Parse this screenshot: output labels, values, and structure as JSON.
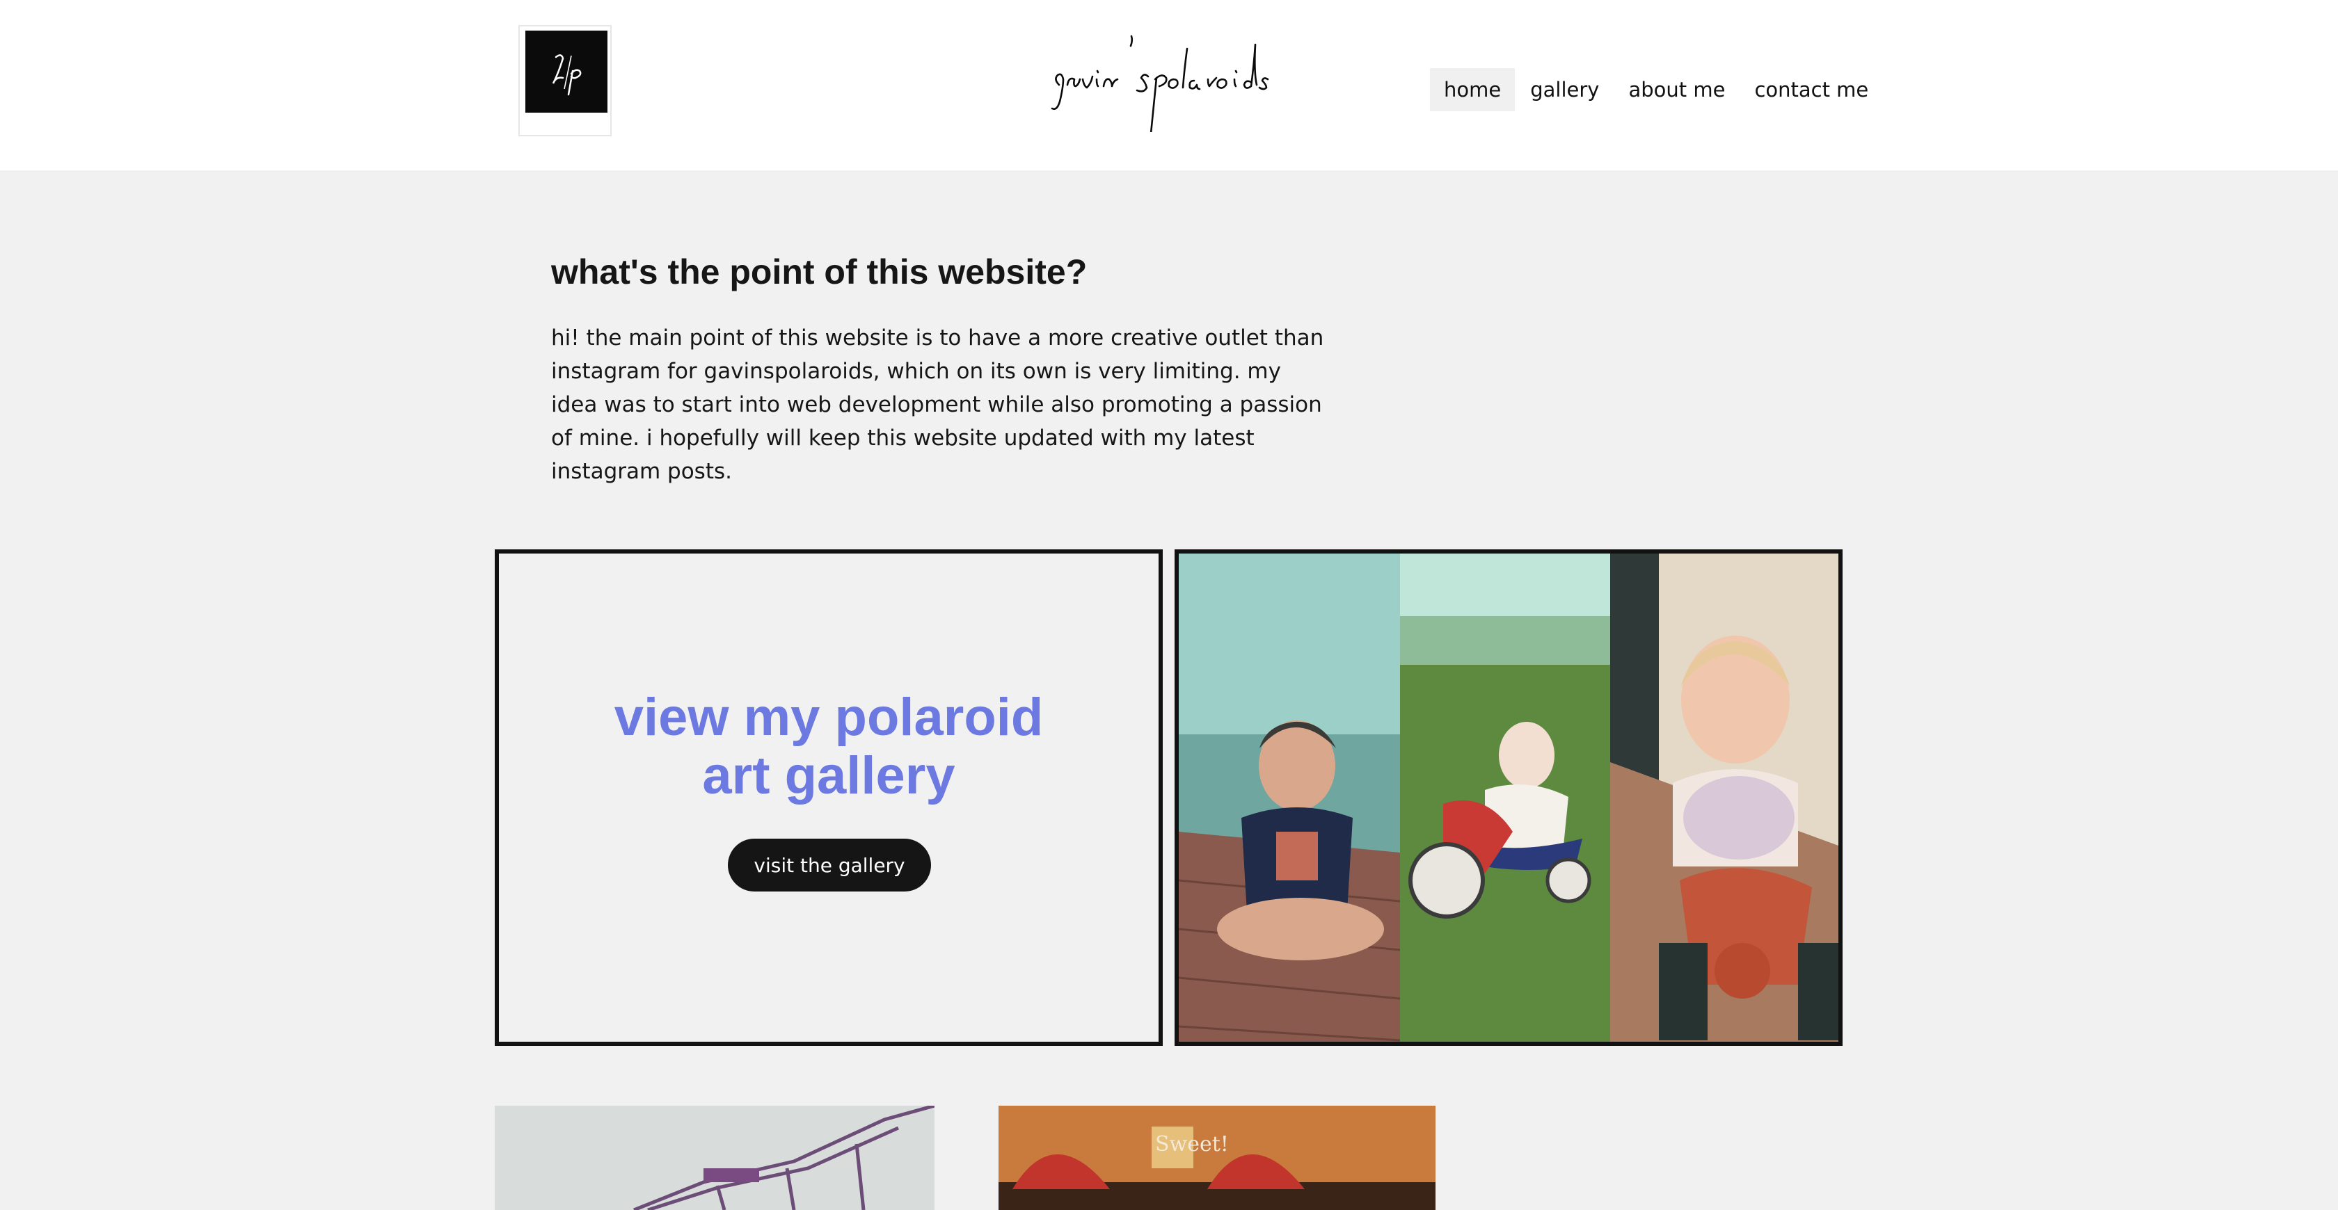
{
  "header": {
    "logo_monogram": "g/p",
    "brand_title": "gavin'spolaroids",
    "nav": [
      {
        "label": "home",
        "active": true
      },
      {
        "label": "gallery",
        "active": false
      },
      {
        "label": "about me",
        "active": false
      },
      {
        "label": "contact me",
        "active": false
      }
    ]
  },
  "intro": {
    "title": "what's the point of this website?",
    "body": "hi! the main point of this website is to have a more creative outlet than instagram for gavinspolaroids, which on its own is very limiting. my idea was to start into web development while also promoting a passion of mine. i hopefully will keep this website updated with my latest instagram posts."
  },
  "feature": {
    "heading_line1": "view my polaroid",
    "heading_line2": "art gallery",
    "button_label": "visit the gallery",
    "accent_color": "#6b79e0"
  },
  "teasers": {
    "sign_text": "Sweet!"
  }
}
